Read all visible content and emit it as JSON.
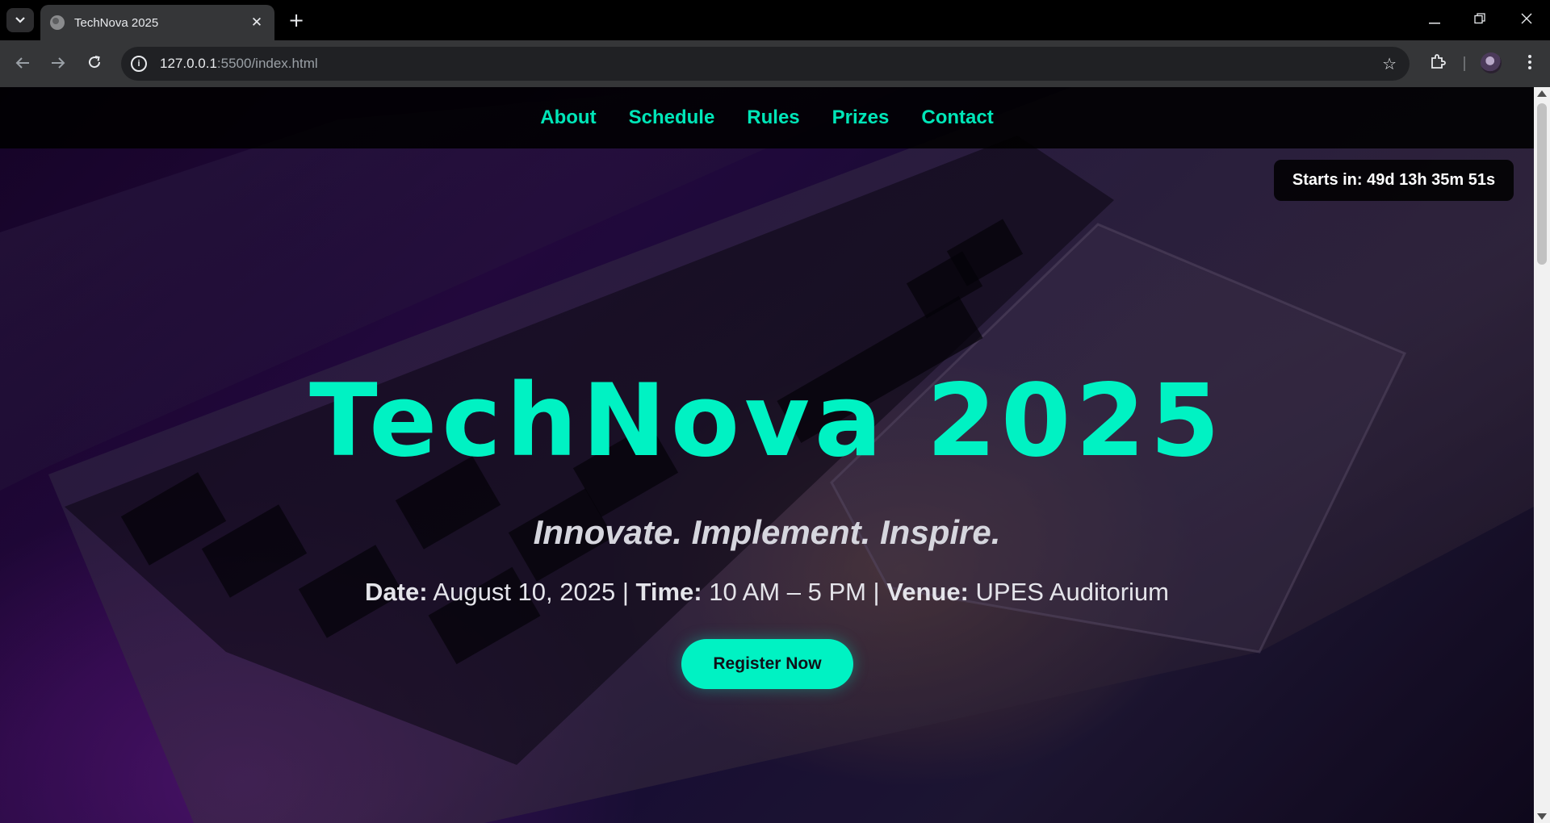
{
  "browser": {
    "tab_title": "TechNova 2025",
    "url_host": "127.0.0.1",
    "url_path": ":5500/index.html",
    "icons": {
      "tab_search": "chevron-down-icon",
      "tab_close": "close-icon",
      "new_tab": "plus-icon",
      "back": "arrow-left-icon",
      "forward": "arrow-right-icon",
      "reload": "reload-icon",
      "site_info": "info-icon",
      "bookmark": "star-icon",
      "extensions": "puzzle-icon",
      "menu": "kebab-menu-icon"
    }
  },
  "site": {
    "nav": [
      {
        "label": "About"
      },
      {
        "label": "Schedule"
      },
      {
        "label": "Rules"
      },
      {
        "label": "Prizes"
      },
      {
        "label": "Contact"
      }
    ],
    "countdown": "Starts in: 49d 13h 35m 51s",
    "hero": {
      "title": "TechNova 2025",
      "tagline": "Innovate. Implement. Inspire.",
      "date_label": "Date:",
      "date_value": " August 10, 2025 | ",
      "time_label": "Time:",
      "time_value": " 10 AM – 5 PM | ",
      "venue_label": "Venue:",
      "venue_value": " UPES Auditorium",
      "register_label": "Register Now"
    },
    "colors": {
      "accent": "#00f2c3",
      "nav_bg": "#000000",
      "text": "#e4e4ea"
    }
  }
}
